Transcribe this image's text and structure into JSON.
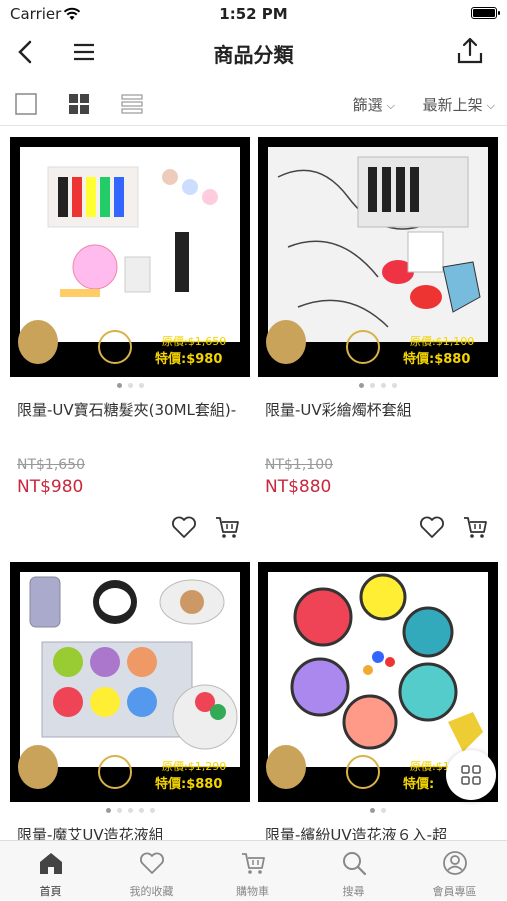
{
  "status_bar": {
    "carrier": "Carrier",
    "time": "1:52 PM"
  },
  "header": {
    "title": "商品分類"
  },
  "toolbar": {
    "filter_label": "篩選",
    "sort_label": "最新上架"
  },
  "products": [
    {
      "name": "限量-UV寶石糖髮夾(30ML套組)-",
      "original_price": "NT$1,650",
      "sale_price": "NT$980",
      "image_banner_original": "原價:$1,650",
      "image_banner_sale": "特價:$980"
    },
    {
      "name": "限量-UV彩繪燭杯套組",
      "original_price": "NT$1,100",
      "sale_price": "NT$880",
      "image_banner_original": "原價:$1,100",
      "image_banner_sale": "特價:$880"
    },
    {
      "name": "限量-魔艾UV造花液組",
      "image_banner_original": "原價:$1,290",
      "image_banner_sale": "特價:$880"
    },
    {
      "name": "限量-繽紛UV造花液６入-超",
      "image_banner_original": "原價:$1,",
      "image_banner_sale": "特價:"
    }
  ],
  "tabbar": [
    {
      "label": "首頁",
      "icon": "home-icon",
      "active": true
    },
    {
      "label": "我的收藏",
      "icon": "heart-icon"
    },
    {
      "label": "購物車",
      "icon": "cart-icon"
    },
    {
      "label": "搜尋",
      "icon": "search-icon"
    },
    {
      "label": "會員專區",
      "icon": "user-icon"
    }
  ],
  "colors": {
    "sale_price": "#c8283c",
    "banner_text": "#f3d400"
  }
}
